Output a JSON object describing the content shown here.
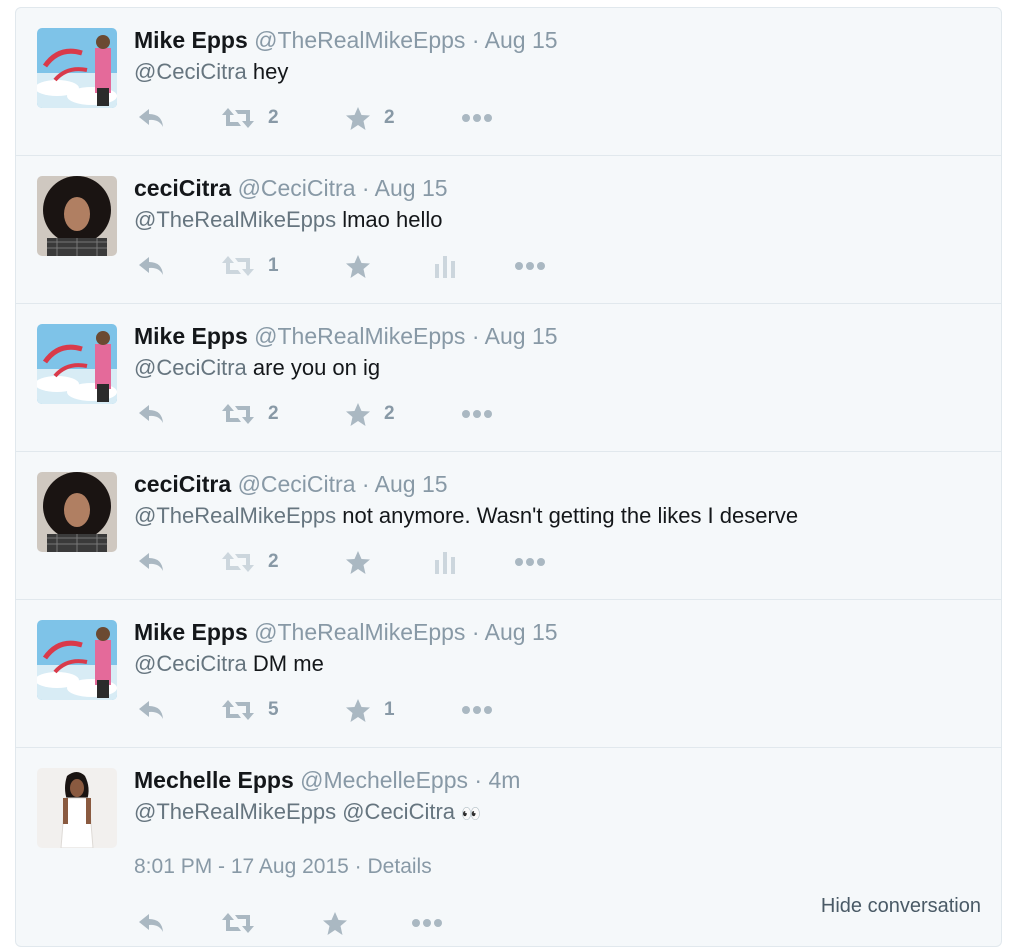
{
  "tweets": [
    {
      "name": "Mike Epps",
      "handle": "@TheRealMikeEpps",
      "time": "Aug 15",
      "mention": "@CeciCitra",
      "body": "hey",
      "retweets": "2",
      "favorites": "2",
      "avatar": "mike"
    },
    {
      "name": "ceciCitra",
      "handle": "@CeciCitra",
      "time": "Aug 15",
      "mention": "@TheRealMikeEpps",
      "body": "lmao hello",
      "retweets": "1",
      "favorites": "",
      "avatar": "ceci"
    },
    {
      "name": "Mike Epps",
      "handle": "@TheRealMikeEpps",
      "time": "Aug 15",
      "mention": "@CeciCitra",
      "body": "are you on ig",
      "retweets": "2",
      "favorites": "2",
      "avatar": "mike"
    },
    {
      "name": "ceciCitra",
      "handle": "@CeciCitra",
      "time": "Aug 15",
      "mention": "@TheRealMikeEpps",
      "body": "not anymore. Wasn't getting the likes I deserve",
      "retweets": "2",
      "favorites": "",
      "avatar": "ceci"
    },
    {
      "name": "Mike Epps",
      "handle": "@TheRealMikeEpps",
      "time": "Aug 15",
      "mention": "@CeciCitra",
      "body": "DM me",
      "retweets": "5",
      "favorites": "1",
      "avatar": "mike"
    }
  ],
  "focused": {
    "name": "Mechelle Epps",
    "handle": "@MechelleEpps",
    "time": "4m",
    "mention1": "@TheRealMikeEpps",
    "mention2": "@CeciCitra",
    "emoji": "👀",
    "timestamp": "8:01 PM - 17 Aug 2015",
    "details": "Details",
    "hide_label": "Hide conversation"
  },
  "separator": "·",
  "colors": {
    "text": "#14171a",
    "muted": "#8899a6",
    "icon": "#aab8c2",
    "border": "#e1e8ed",
    "bg": "#f5f8fa"
  },
  "icons": [
    "reply-icon",
    "retweet-icon",
    "favorite-star-icon",
    "more-ellipsis-icon",
    "analytics-icon"
  ]
}
